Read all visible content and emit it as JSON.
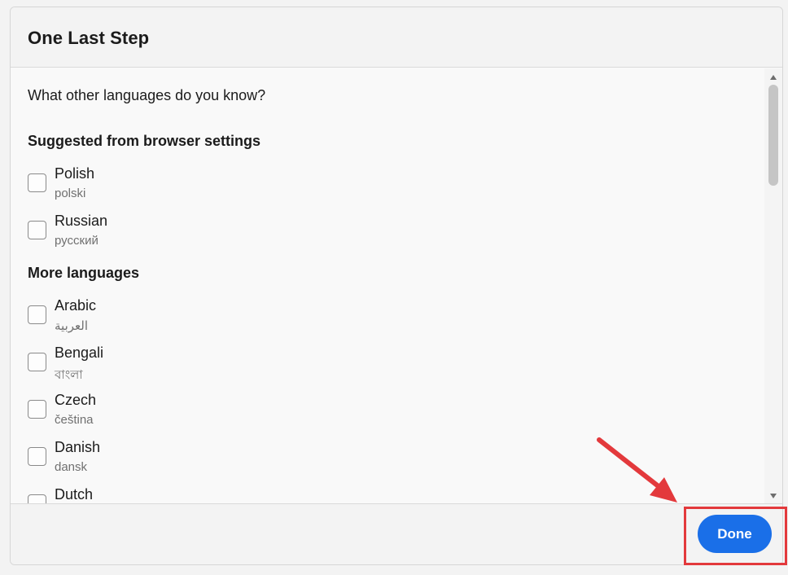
{
  "dialog": {
    "title": "One Last Step",
    "question": "What other languages do you know?",
    "sections": {
      "suggested": {
        "heading": "Suggested from browser settings",
        "items": [
          {
            "name": "Polish",
            "native": "polski",
            "checked": false
          },
          {
            "name": "Russian",
            "native": "русский",
            "checked": false
          }
        ]
      },
      "more": {
        "heading": "More languages",
        "items": [
          {
            "name": "Arabic",
            "native": "العربية",
            "checked": false
          },
          {
            "name": "Bengali",
            "native": "বাংলা",
            "checked": false
          },
          {
            "name": "Czech",
            "native": "čeština",
            "checked": false
          },
          {
            "name": "Danish",
            "native": "dansk",
            "checked": false
          },
          {
            "name": "Dutch",
            "native": "",
            "checked": false
          }
        ]
      }
    },
    "footer": {
      "done_label": "Done"
    }
  },
  "colors": {
    "accent": "#1a6fe8",
    "annotation": "#e3393c"
  }
}
